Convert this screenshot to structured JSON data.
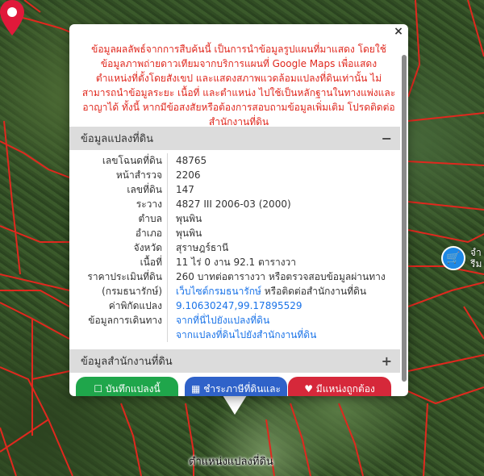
{
  "map": {
    "pin_label": "ตำแหน่งแปลงที่ดิน",
    "poi_icon": "shopping-cart-icon",
    "poi_label_line1": "จำ",
    "poi_label_line2": "รีม",
    "boundary_color": "#e0281e"
  },
  "popup": {
    "close_label": "×",
    "disclaimer": "ข้อมูลผลลัพธ์จากการสืบค้นนี้ เป็นการนำข้อมูลรูปแผนที่มาแสดง โดยใช้ข้อมูลภาพถ่ายดาวเทียมจากบริการแผนที่ Google Maps เพื่อแสดงตำแหน่งที่ตั้งโดยสังเขป และแสดงสภาพแวดล้อมแปลงที่ดินเท่านั้น ไม่สามารถนำข้อมูลระยะ เนื้อที่ และตำแหน่ง ไปใช้เป็นหลักฐานในทางแพ่งและอาญาได้ ทั้งนี้ หากมีข้อสงสัยหรือต้องการสอบถามข้อมูลเพิ่มเติม โปรดติดต่อสำนักงานที่ดิน",
    "section1": {
      "title": "ข้อมูลแปลงที่ดิน",
      "toggle": "−"
    },
    "rows": [
      {
        "label": "เลขโฉนดที่ดิน",
        "value": "48765"
      },
      {
        "label": "หน้าสำรวจ",
        "value": "2206"
      },
      {
        "label": "เลขที่ดิน",
        "value": "147"
      },
      {
        "label": "ระวาง",
        "value": "4827 III 2006-03 (2000)"
      },
      {
        "label": "ตำบล",
        "value": "พุนพิน"
      },
      {
        "label": "อำเภอ",
        "value": "พุนพิน"
      },
      {
        "label": "จังหวัด",
        "value": "สุราษฎร์ธานี"
      },
      {
        "label": "เนื้อที่",
        "value": "11 ไร่ 0 งาน 92.1 ตารางวา"
      },
      {
        "label": "ราคาประเมินที่ดิน",
        "value": "260 บาทต่อตารางวา หรือตรวจสอบข้อมูลผ่านทาง"
      },
      {
        "label": "(กรมธนารักษ์)",
        "value_link": "เว็บไซต์กรมธนารักษ์",
        "value": " หรือติดต่อสำนักงานที่ดิน"
      },
      {
        "label": "ค่าพิกัดแปลง",
        "value_link": "9.10630247,99.17895529"
      },
      {
        "label": "ข้อมูลการเดินทาง",
        "value_link": "จากที่นี่ไปยังแปลงที่ดิน"
      },
      {
        "label": "",
        "value_link": "จากแปลงที่ดินไปยังสำนักงานที่ดิน"
      }
    ],
    "section2": {
      "title": "ข้อมูลสำนักงานที่ดิน",
      "toggle": "+"
    },
    "buttons": {
      "save": "บันทึกแปลงนี้",
      "pay": "ชำระภาษีที่ดินและ",
      "fav": "มีแหน่งถูกต้อง"
    }
  }
}
